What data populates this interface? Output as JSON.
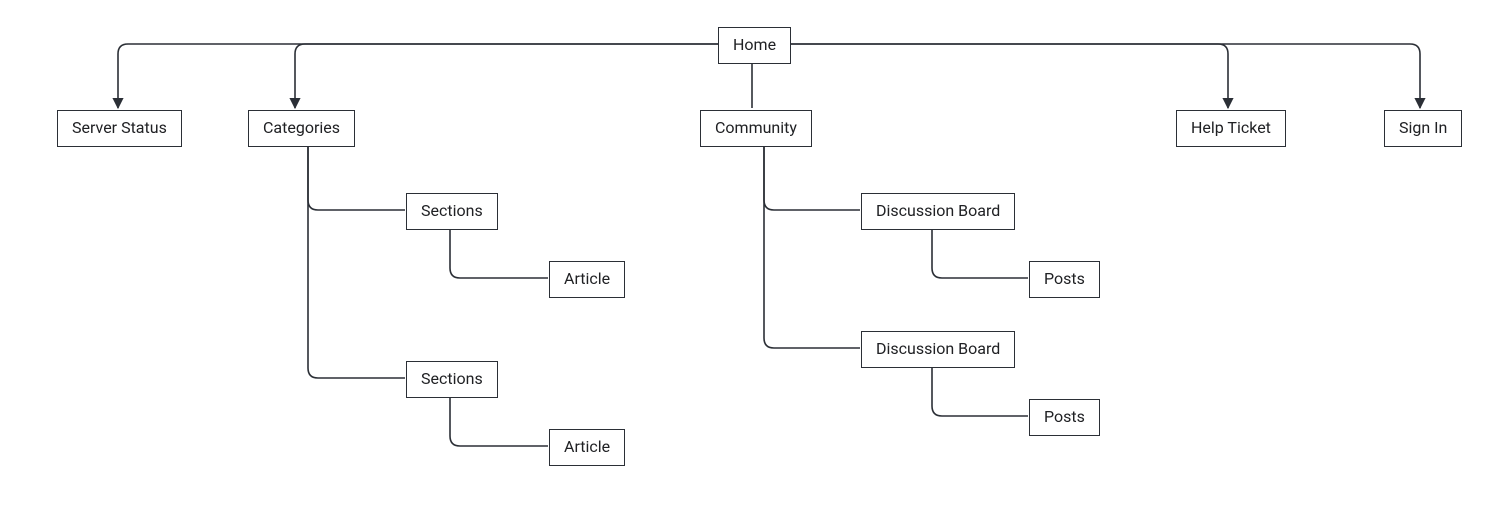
{
  "diagram": {
    "type": "sitemap-tree",
    "stroke": "#2b2f36",
    "nodes": {
      "home": {
        "label": "Home"
      },
      "server_status": {
        "label": "Server Status"
      },
      "categories": {
        "label": "Categories"
      },
      "community": {
        "label": "Community"
      },
      "help_ticket": {
        "label": "Help Ticket"
      },
      "sign_in": {
        "label": "Sign In"
      },
      "sections_1": {
        "label": "Sections"
      },
      "article_1": {
        "label": "Article"
      },
      "sections_2": {
        "label": "Sections"
      },
      "article_2": {
        "label": "Article"
      },
      "discussion_1": {
        "label": "Discussion Board"
      },
      "posts_1": {
        "label": "Posts"
      },
      "discussion_2": {
        "label": "Discussion Board"
      },
      "posts_2": {
        "label": "Posts"
      }
    },
    "edges": [
      [
        "home",
        "server_status"
      ],
      [
        "home",
        "categories"
      ],
      [
        "home",
        "community"
      ],
      [
        "home",
        "help_ticket"
      ],
      [
        "home",
        "sign_in"
      ],
      [
        "categories",
        "sections_1"
      ],
      [
        "sections_1",
        "article_1"
      ],
      [
        "categories",
        "sections_2"
      ],
      [
        "sections_2",
        "article_2"
      ],
      [
        "community",
        "discussion_1"
      ],
      [
        "discussion_1",
        "posts_1"
      ],
      [
        "community",
        "discussion_2"
      ],
      [
        "discussion_2",
        "posts_2"
      ]
    ]
  }
}
